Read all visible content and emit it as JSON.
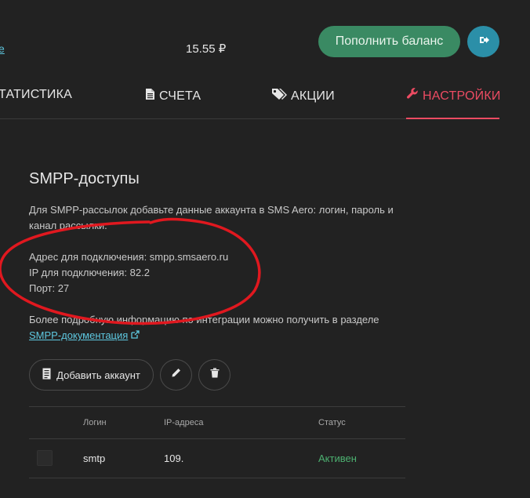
{
  "header": {
    "cut_link": "e",
    "balance": "15.55 ₽",
    "topup_label": "Пополнить баланс",
    "logout_icon": "logout-icon"
  },
  "nav": {
    "items": [
      {
        "label": "ТАТИСТИКА",
        "icon": "",
        "active": false
      },
      {
        "label": "СЧЕТА",
        "icon": "document-icon",
        "active": false
      },
      {
        "label": "АКЦИИ",
        "icon": "tags-icon",
        "active": false
      },
      {
        "label": "НАСТРОЙКИ",
        "icon": "wrench-icon",
        "active": true
      }
    ],
    "active_color": "#ec4b62"
  },
  "smpp": {
    "title": "SMPP-доступы",
    "intro_line1": "Для SMPP-рассылок добавьте данные аккаунта в SMS Aero: логин, пароль и",
    "intro_line2": "канал рассылки.",
    "address": "Адрес для подключения: smpp.smsaero.ru",
    "ip": "IP для подключения: 82.2",
    "port": "Порт: 27",
    "more_info": "Более подробную информацию по интеграции можно получить в разделе",
    "docs_link": "SMPP-документация"
  },
  "actions": {
    "add_account_label": "Добавить аккаунт",
    "add_icon": "document-icon",
    "edit_icon": "pencil-icon",
    "delete_icon": "trash-icon"
  },
  "table": {
    "columns": [
      "Логин",
      "IP-адреса",
      "Статус"
    ],
    "rows": [
      {
        "login": "smtp",
        "ip": "109.",
        "status": "Активен"
      }
    ]
  },
  "colors": {
    "background": "#222222",
    "accent_green": "#3a8a63",
    "accent_teal": "#2b8fa8",
    "status_active": "#4cb070",
    "annotation_red": "#e0181f"
  }
}
